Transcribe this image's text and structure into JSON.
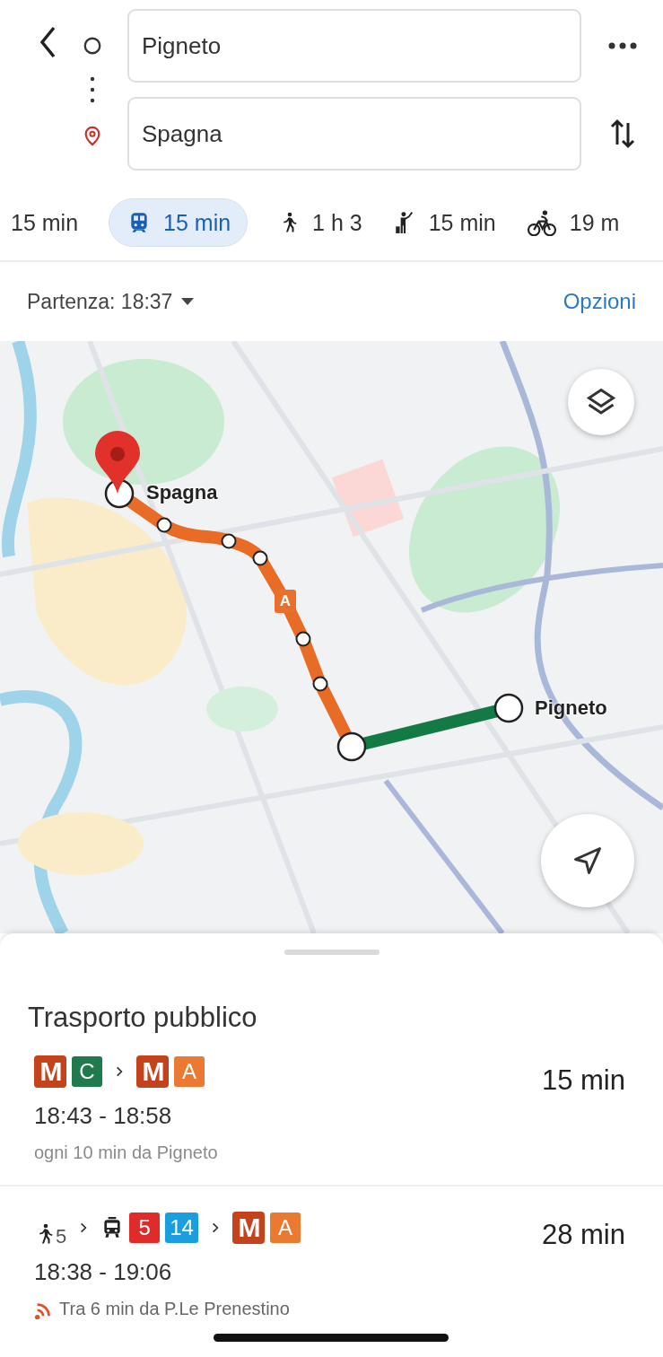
{
  "origin": {
    "value": "Pigneto"
  },
  "destination": {
    "value": "Spagna"
  },
  "modes": [
    {
      "kind": "car",
      "label": "15 min",
      "selected": false
    },
    {
      "kind": "transit",
      "label": "15 min",
      "selected": true
    },
    {
      "kind": "walk",
      "label": "1 h 3",
      "selected": false
    },
    {
      "kind": "hail",
      "label": "15 min",
      "selected": false
    },
    {
      "kind": "bike",
      "label": "19 m",
      "selected": false
    }
  ],
  "departure": {
    "label": "Partenza: 18:37"
  },
  "options_link": "Opzioni",
  "map": {
    "destination_label": "Spagna",
    "origin_label": "Pigneto",
    "line_badge": "A"
  },
  "sheet": {
    "title": "Trasporto pubblico",
    "routes": [
      {
        "segments": [
          {
            "kind": "metro",
            "label": "M",
            "color": "#c4421c"
          },
          {
            "kind": "line",
            "label": "C",
            "color": "#1f7a4d"
          },
          {
            "kind": "chevron"
          },
          {
            "kind": "metro",
            "label": "M",
            "color": "#c4421c"
          },
          {
            "kind": "line",
            "label": "A",
            "color": "#ea7a32"
          }
        ],
        "duration": "15 min",
        "times": "18:43 - 18:58",
        "note": "ogni 10 min da Pigneto",
        "realtime": false
      },
      {
        "segments": [
          {
            "kind": "walk",
            "label": "5"
          },
          {
            "kind": "chevron"
          },
          {
            "kind": "bus"
          },
          {
            "kind": "line",
            "label": "5",
            "color": "#e02b2b"
          },
          {
            "kind": "line",
            "label": "14",
            "color": "#1a9ee0"
          },
          {
            "kind": "chevron"
          },
          {
            "kind": "metro",
            "label": "M",
            "color": "#c4421c"
          },
          {
            "kind": "line",
            "label": "A",
            "color": "#ea7a32"
          }
        ],
        "duration": "28 min",
        "times": "18:38 - 19:06",
        "note": "Tra 6 min da P.Le Prenestino",
        "realtime": true
      }
    ]
  }
}
